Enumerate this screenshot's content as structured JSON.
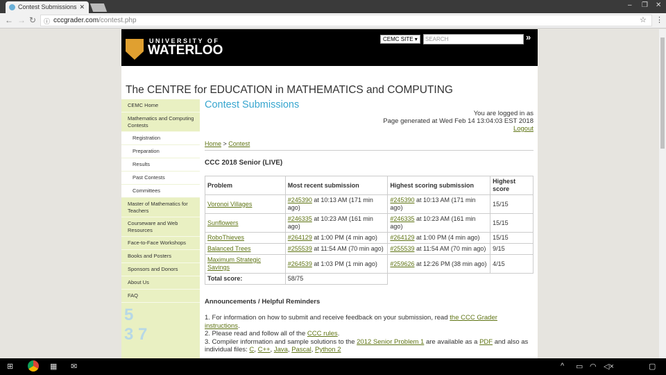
{
  "browser": {
    "tab_title": "Contest Submissions",
    "url_domain": "cccgrader.com",
    "url_path": "/contest.php"
  },
  "header": {
    "uni_line1": "UNIVERSITY OF",
    "uni_line2": "WATERLOO",
    "site_select": "CEMC SITE ▾",
    "search_placeholder": "SEARCH",
    "go": "»"
  },
  "site_title": "The CENTRE for EDUCATION in MATHEMATICS and COMPUTING",
  "sidebar": {
    "items": [
      {
        "label": "CEMC Home",
        "sub": false
      },
      {
        "label": "Mathematics and Computing Contests",
        "sub": false
      },
      {
        "label": "Registration",
        "sub": true
      },
      {
        "label": "Preparation",
        "sub": true
      },
      {
        "label": "Results",
        "sub": true
      },
      {
        "label": "Past Contests",
        "sub": true
      },
      {
        "label": "Committees",
        "sub": true
      },
      {
        "label": "Master of Mathematics for Teachers",
        "sub": false
      },
      {
        "label": "Courseware and Web Resources",
        "sub": false
      },
      {
        "label": "Face-to-Face Workshops",
        "sub": false
      },
      {
        "label": "Books and Posters",
        "sub": false
      },
      {
        "label": "Sponsors and Donors",
        "sub": false
      },
      {
        "label": "About Us",
        "sub": false
      },
      {
        "label": "FAQ",
        "sub": false
      }
    ]
  },
  "main": {
    "heading": "Contest Submissions",
    "logged_in": "You are logged in as",
    "generated": "Page generated at Wed Feb 14 13:04:03 EST 2018",
    "logout": "Logout",
    "crumb_home": "Home",
    "crumb_sep": " > ",
    "crumb_contest": "Contest",
    "contest_title": "CCC 2018 Senior (LIVE)",
    "table": {
      "headers": [
        "Problem",
        "Most recent submission",
        "Highest scoring submission",
        "Highest score"
      ],
      "rows": [
        {
          "problem": "Voronoi Villages",
          "recent_id": "#245390",
          "recent_time": " at 10:13 AM (171 min ago)",
          "high_id": "#245390",
          "high_time": " at 10:13 AM (171 min ago)",
          "score": "15/15"
        },
        {
          "problem": "Sunflowers",
          "recent_id": "#246335",
          "recent_time": " at 10:23 AM (161 min ago)",
          "high_id": "#246335",
          "high_time": " at 10:23 AM (161 min ago)",
          "score": "15/15"
        },
        {
          "problem": "RoboThieves",
          "recent_id": "#264129",
          "recent_time": " at 1:00 PM (4 min ago)",
          "high_id": "#264129",
          "high_time": " at 1:00 PM (4 min ago)",
          "score": "15/15"
        },
        {
          "problem": "Balanced Trees",
          "recent_id": "#255539",
          "recent_time": " at 11:54 AM (70 min ago)",
          "high_id": "#255539",
          "high_time": " at 11:54 AM (70 min ago)",
          "score": "9/15"
        },
        {
          "problem": "Maximum Strategic Savings",
          "recent_id": "#264539",
          "recent_time": " at 1:03 PM (1 min ago)",
          "high_id": "#259626",
          "high_time": " at 12:26 PM (38 min ago)",
          "score": "4/15"
        }
      ],
      "total_label": "Total score:",
      "total_value": "58/75"
    },
    "announcements": {
      "title": "Announcements / Helpful Reminders",
      "l1a": "1. For information on how to submit and receive feedback on your submission, read ",
      "l1link": "the CCC Grader instructions",
      "l1b": ".",
      "l2a": "2. Please read and follow all of the ",
      "l2link": "CCC rules",
      "l2b": ".",
      "l3a": "3. Compiler information and sample solutions to the ",
      "l3link": "2012 Senior Problem 1",
      "l3b": " are available as a ",
      "l3pdf": "PDF",
      "l3c": " and also as individual files: ",
      "files": [
        "C",
        "C++",
        "Java",
        "Pascal",
        "Python 2"
      ]
    }
  }
}
